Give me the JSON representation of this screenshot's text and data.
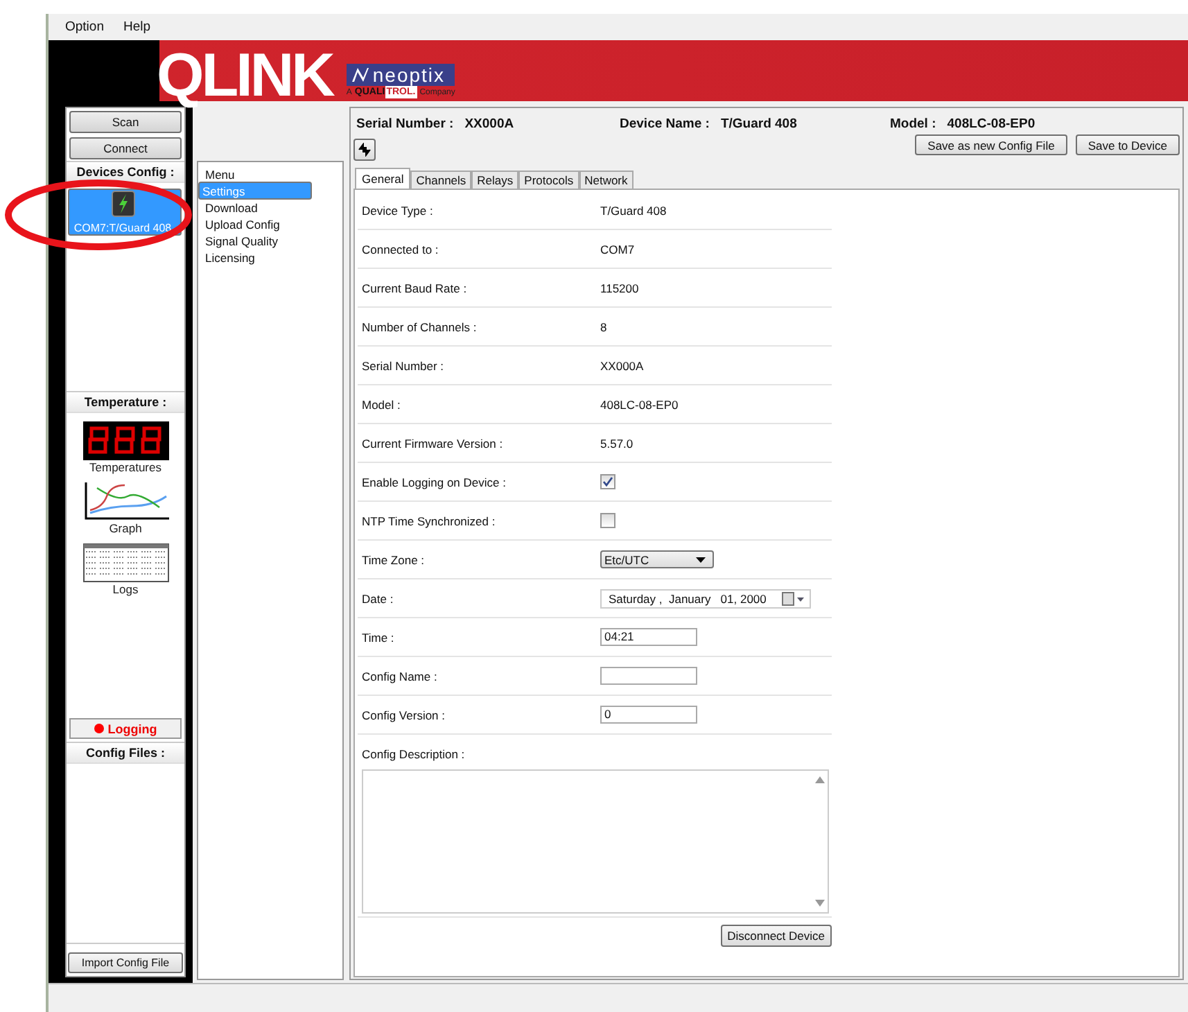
{
  "menubar": [
    "Option",
    "Help"
  ],
  "banner": {
    "logo": "QLINK",
    "brand": "neoptix",
    "tagline": [
      {
        "kind": "plain",
        "text": "A"
      },
      {
        "kind": "dark",
        "text": "QUALI"
      },
      {
        "kind": "boxed",
        "text": "TROL."
      },
      {
        "kind": "plain",
        "text": "Company"
      }
    ]
  },
  "left_panel": {
    "buttons": [
      "Scan",
      "Connect"
    ],
    "devices_header": "Devices Config :",
    "devices": [
      {
        "label": "COM7:T/Guard 408",
        "selected": true
      }
    ],
    "temperature_header": "Temperature :",
    "tools": [
      {
        "kind": "temperatures",
        "label": "Temperatures"
      },
      {
        "kind": "graph",
        "label": "Graph"
      },
      {
        "kind": "logs",
        "label": "Logs"
      }
    ],
    "logging": {
      "label": "Logging",
      "on": true
    },
    "config_files_header": "Config Files :",
    "import_button": "Import Config File"
  },
  "menu": {
    "title": "Menu",
    "items": [
      {
        "label": "Settings",
        "selected": true
      },
      {
        "label": "Download",
        "selected": false
      },
      {
        "label": "Upload Config",
        "selected": false
      },
      {
        "label": "Signal Quality",
        "selected": false
      },
      {
        "label": "Licensing",
        "selected": false
      }
    ]
  },
  "header": {
    "fields": [
      {
        "label": "Serial Number :",
        "value": "XX000A"
      },
      {
        "label": "Device Name :",
        "value": "T/Guard 408"
      },
      {
        "label": "Model :",
        "value": "408LC-08-EP0"
      }
    ],
    "buttons": [
      "Save as new Config File",
      "Save to Device"
    ]
  },
  "tabs": [
    {
      "label": "General",
      "selected": true
    },
    {
      "label": "Channels",
      "selected": false
    },
    {
      "label": "Relays",
      "selected": false
    },
    {
      "label": "Protocols",
      "selected": false
    },
    {
      "label": "Network",
      "selected": false
    }
  ],
  "form": [
    {
      "kind": "text",
      "label": "Device Type :",
      "value": "T/Guard 408"
    },
    {
      "kind": "text",
      "label": "Connected to :",
      "value": "COM7"
    },
    {
      "kind": "text",
      "label": "Current Baud Rate :",
      "value": "115200"
    },
    {
      "kind": "text",
      "label": "Number of Channels :",
      "value": "8"
    },
    {
      "kind": "text",
      "label": "Serial Number :",
      "value": "XX000A"
    },
    {
      "kind": "text",
      "label": "Model :",
      "value": "408LC-08-EP0"
    },
    {
      "kind": "text",
      "label": "Current Firmware Version :",
      "value": "5.57.0"
    },
    {
      "kind": "checkbox",
      "label": "Enable Logging on Device :",
      "checked": true
    },
    {
      "kind": "checkbox",
      "label": "NTP Time Synchronized :",
      "checked": false
    },
    {
      "kind": "select",
      "label": "Time Zone :",
      "value": "Etc/UTC"
    },
    {
      "kind": "date",
      "label": "Date :",
      "value": "Saturday ,  January   01, 2000"
    },
    {
      "kind": "input",
      "label": "Time :",
      "value": "04:21"
    },
    {
      "kind": "input",
      "label": "Config Name :"
    },
    {
      "kind": "input",
      "label": "Config Version :",
      "value": "0"
    },
    {
      "kind": "textarea",
      "label": "Config Description :"
    }
  ],
  "disconnect_button": "Disconnect Device",
  "highlight": {
    "kind": "ellipse"
  }
}
